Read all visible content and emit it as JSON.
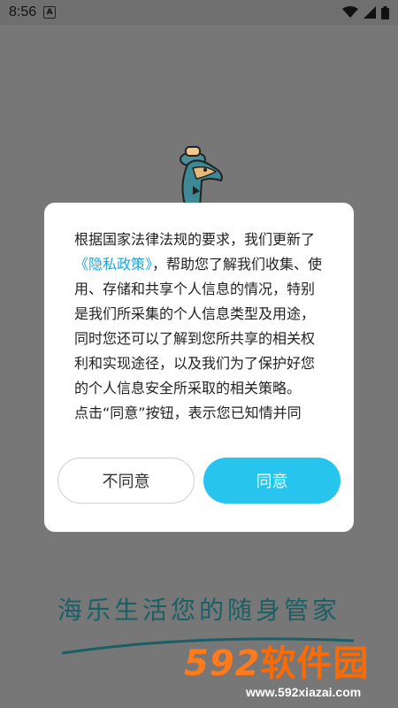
{
  "status_bar": {
    "time": "8:56",
    "notif_icon": "a-letter-icon"
  },
  "dialog": {
    "body_prefix": "根据国家法律法规的要求，我们更新了",
    "policy_link": "《隐私政策》",
    "body_suffix": "，帮助您了解我们收集、使用、存储和共享个人信息的情况，特别是我们所采集的个人信息类型及用途，同时您还可以了解到您所共享的相关权利和实现途径，以及我们为了保护好您的个人信息安全所采取的相关策略。",
    "body_more": "点击“同意”按钮，表示您已知情并同",
    "disagree_label": "不同意",
    "agree_label": "同意"
  },
  "slogan": "海乐生活您的随身管家",
  "watermark": {
    "logo_num": "592",
    "logo_text": "软件园",
    "url": "www.592xiazai.com"
  },
  "colors": {
    "accent": "#27c5ee",
    "link": "#1aa7d6",
    "slogan": "#1b5f66",
    "watermark": "#ff6a00"
  }
}
